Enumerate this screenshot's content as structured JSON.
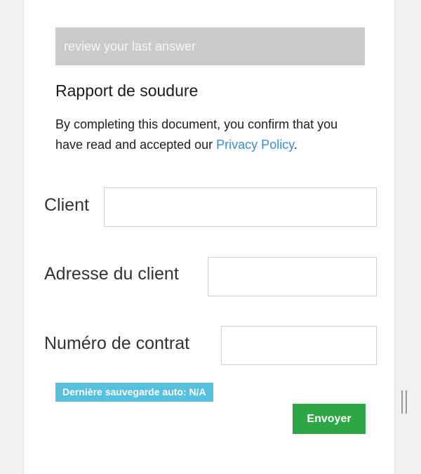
{
  "banner": {
    "text": "review your last answer"
  },
  "document": {
    "title": "Rapport de soudure",
    "consent_prefix": "By completing this document, you confirm that you have read and accepted our ",
    "privacy_link": "Privacy Policy",
    "consent_suffix": "."
  },
  "fields": [
    {
      "label": "Client",
      "value": ""
    },
    {
      "label": "Adresse du client",
      "value": ""
    },
    {
      "label": "Numéro de contrat",
      "value": ""
    }
  ],
  "autosave": {
    "text": "Dernière sauvegarde auto: N/A",
    "color": "#57c0dd"
  },
  "submit": {
    "label": "Envoyer",
    "color": "#2fa646"
  },
  "colors": {
    "link": "#3d8fd1",
    "banner_bg": "#cbcacb"
  }
}
